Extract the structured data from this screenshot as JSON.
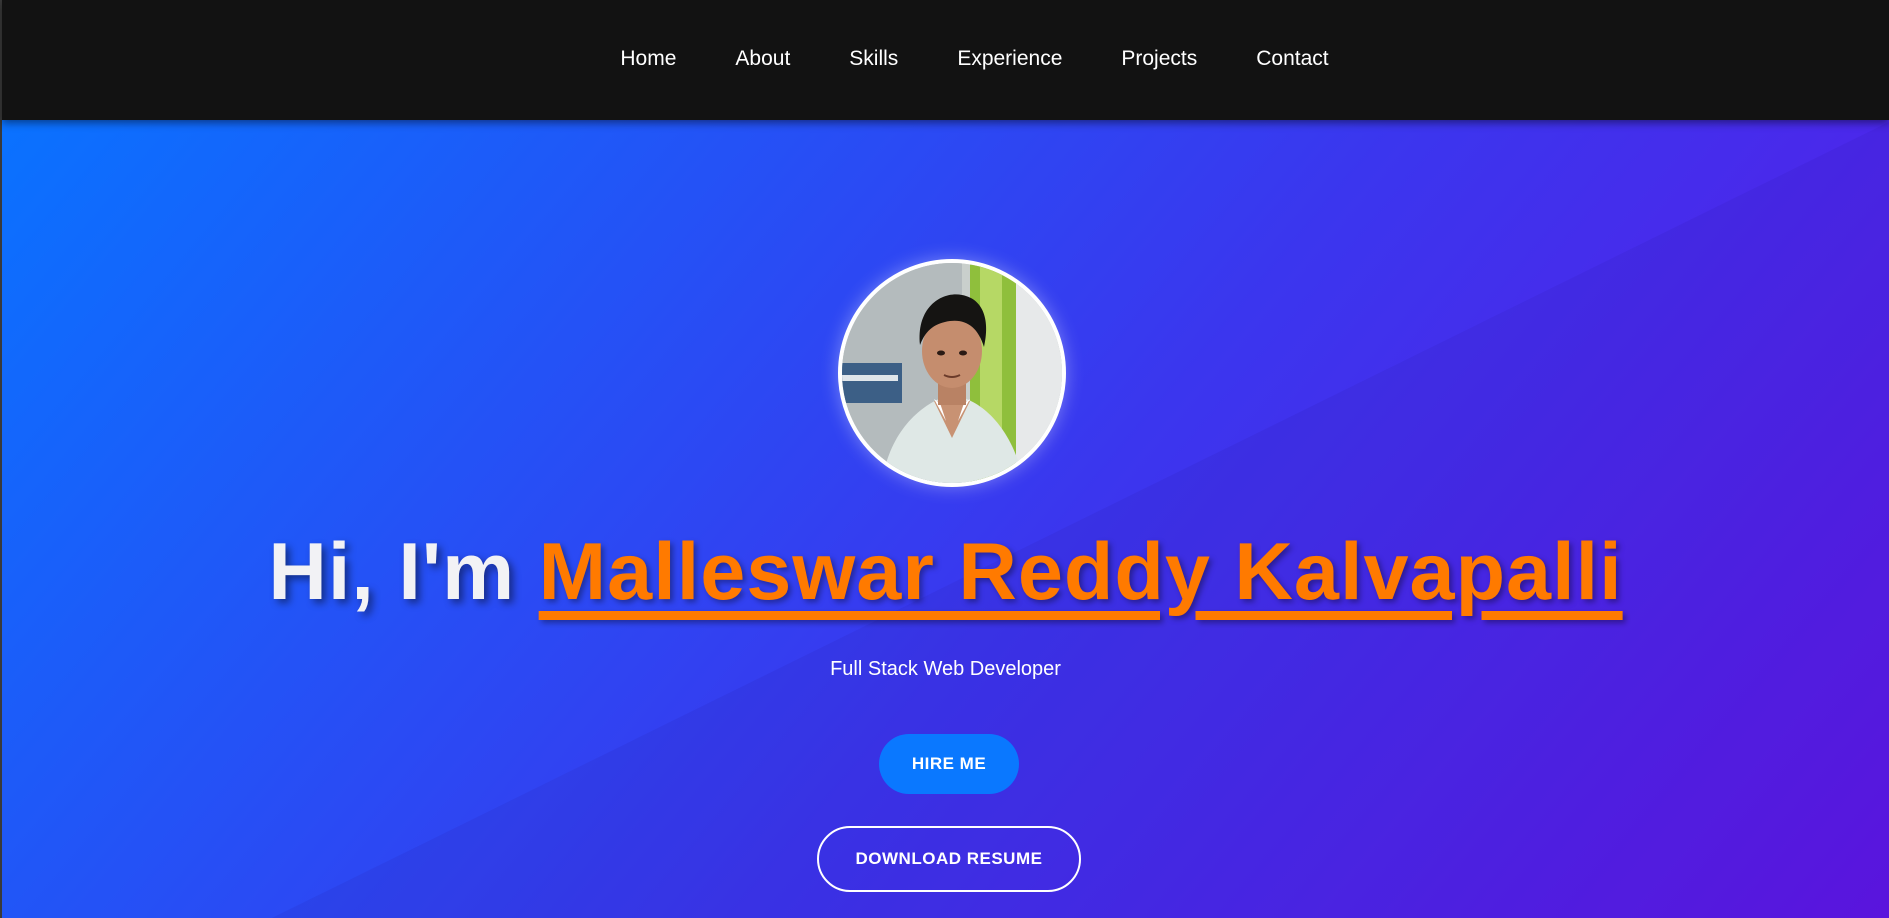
{
  "nav": {
    "items": [
      {
        "label": "Home"
      },
      {
        "label": "About"
      },
      {
        "label": "Skills"
      },
      {
        "label": "Experience"
      },
      {
        "label": "Projects"
      },
      {
        "label": "Contact"
      }
    ]
  },
  "hero": {
    "greeting": "Hi, I'm",
    "name": "Malleswar Reddy Kalvapalli",
    "subtitle": "Full Stack Web Developer",
    "primary_button": "HIRE ME",
    "secondary_button": "DOWNLOAD RESUME"
  },
  "colors": {
    "navbar_bg": "#121212",
    "gradient_start": "#0a72ff",
    "gradient_mid": "#3b36ee",
    "gradient_end": "#6015e6",
    "name_accent": "#ff7a00",
    "primary_button_bg": "#0a78ff"
  }
}
